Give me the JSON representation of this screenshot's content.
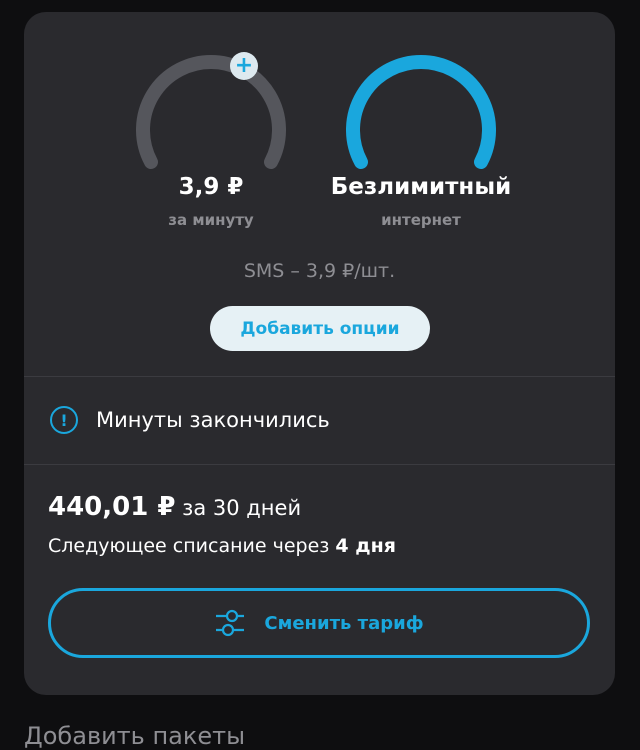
{
  "gauges": [
    {
      "value": "3,9 ₽",
      "sub": "за минуту",
      "fill": 0,
      "color": "#55565c"
    },
    {
      "value": "Безлимитный",
      "sub": "интернет",
      "fill": 1,
      "color": "#1aa7dd"
    }
  ],
  "plus_symbol": "+",
  "sms_text": "SMS – 3,9 ₽/шт.",
  "add_options_label": "Добавить опции",
  "alert": {
    "icon": "!",
    "text": "Минуты закончились"
  },
  "price": {
    "amount": "440,01 ₽",
    "period": "за 30 дней"
  },
  "next_charge": {
    "prefix": "Следующее списание через",
    "days": "4 дня"
  },
  "change_tariff_label": "Сменить тариф",
  "bottom_text": "Добавить пакеты",
  "colors": {
    "accent": "#1aa7dd",
    "card": "#2a2a2e",
    "background": "#0e0e10"
  }
}
